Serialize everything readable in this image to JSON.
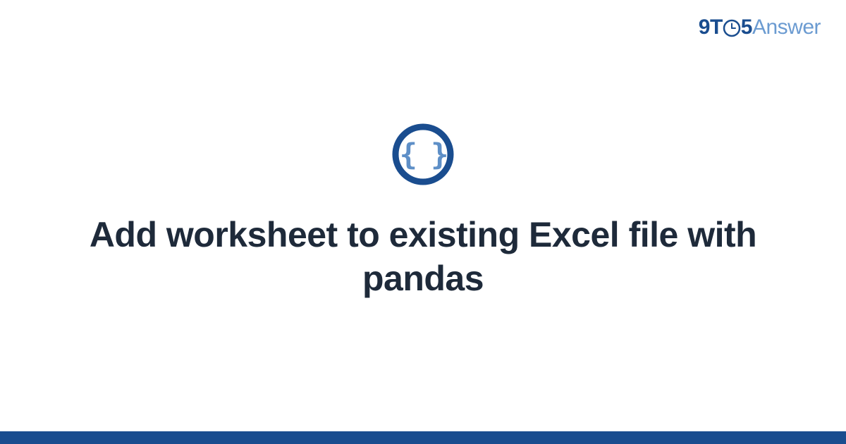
{
  "brand": {
    "nine": "9",
    "t": "T",
    "five": "5",
    "answer": "Answer"
  },
  "icon": {
    "name": "code-braces-icon"
  },
  "title": "Add worksheet to existing Excel file with pandas",
  "colors": {
    "brand_primary": "#1a4d8f",
    "brand_secondary": "#6b9bd1",
    "title_text": "#1e2a3a",
    "icon_ring": "#1a4d8f",
    "icon_braces": "#5e8fc7"
  }
}
